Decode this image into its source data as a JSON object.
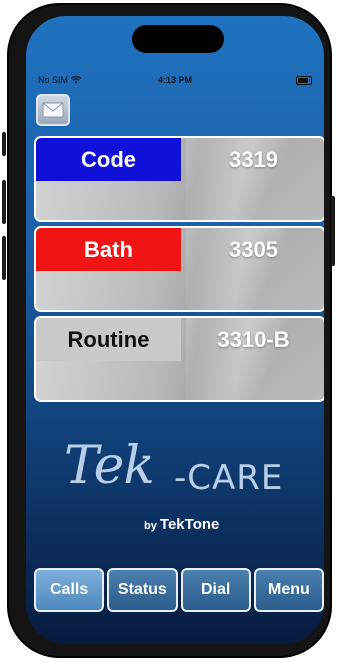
{
  "status_bar": {
    "carrier": "No SIM",
    "time": "4:13 PM"
  },
  "calls": [
    {
      "type": "Code",
      "room": "3319",
      "type_color": "#1010d8",
      "type_text_color": "#ffffff"
    },
    {
      "type": "Bath",
      "room": "3305",
      "type_color": "#f01414",
      "type_text_color": "#ffffff"
    },
    {
      "type": "Routine",
      "room": "3310-B",
      "type_color": "#c9c9c9",
      "type_text_color": "#111111"
    }
  ],
  "logo": {
    "tek": "Tek",
    "care": "-CARE",
    "by": "by",
    "brand": "TekTone"
  },
  "tabs": [
    {
      "label": "Calls",
      "active": true
    },
    {
      "label": "Status",
      "active": false
    },
    {
      "label": "Dial",
      "active": false
    },
    {
      "label": "Menu",
      "active": false
    }
  ],
  "colors": {
    "background_top": "#1f72c0",
    "background_bottom": "#071a3d"
  }
}
